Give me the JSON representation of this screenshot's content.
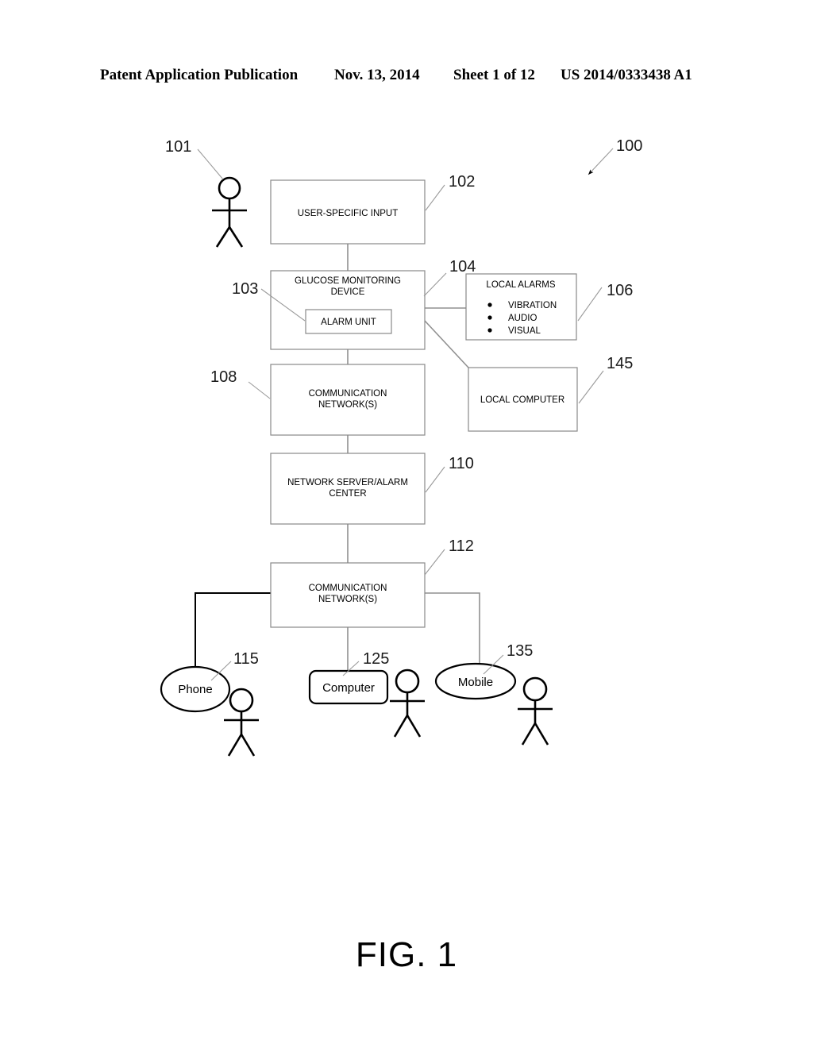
{
  "header": {
    "publication": "Patent Application Publication",
    "date": "Nov. 13, 2014",
    "sheet": "Sheet 1 of 12",
    "patent_number": "US 2014/0333438 A1"
  },
  "figure": {
    "caption": "FIG. 1",
    "system_ref": "100"
  },
  "blocks": {
    "user_specific_input": {
      "label": "USER-SPECIFIC INPUT",
      "ref": "102"
    },
    "glucose_monitoring_device": {
      "line1": "GLUCOSE MONITORING",
      "line2": "DEVICE",
      "ref": "104"
    },
    "alarm_unit": {
      "label": "ALARM UNIT",
      "ref": "103"
    },
    "local_alarms": {
      "title": "LOCAL ALARMS",
      "ref": "106",
      "items": [
        "VIBRATION",
        "AUDIO",
        "VISUAL"
      ]
    },
    "communication_network_upper": {
      "line1": "COMMUNICATION",
      "line2": "NETWORK(S)",
      "ref": "108"
    },
    "local_computer": {
      "label": "LOCAL COMPUTER",
      "ref": "145"
    },
    "network_server": {
      "line1": "NETWORK SERVER/ALARM",
      "line2": "CENTER",
      "ref": "110"
    },
    "communication_network_lower": {
      "line1": "COMMUNICATION",
      "line2": "NETWORK(S)",
      "ref": "112"
    },
    "phone": {
      "label": "Phone",
      "ref": "115"
    },
    "computer": {
      "label": "Computer",
      "ref": "125"
    },
    "mobile": {
      "label": "Mobile",
      "ref": "135"
    }
  },
  "actors": {
    "patient": {
      "ref": "101"
    }
  },
  "colors": {
    "ink": "#000000",
    "box_stroke": "#888888",
    "leader": "#9a9a9a",
    "background": "#ffffff"
  }
}
